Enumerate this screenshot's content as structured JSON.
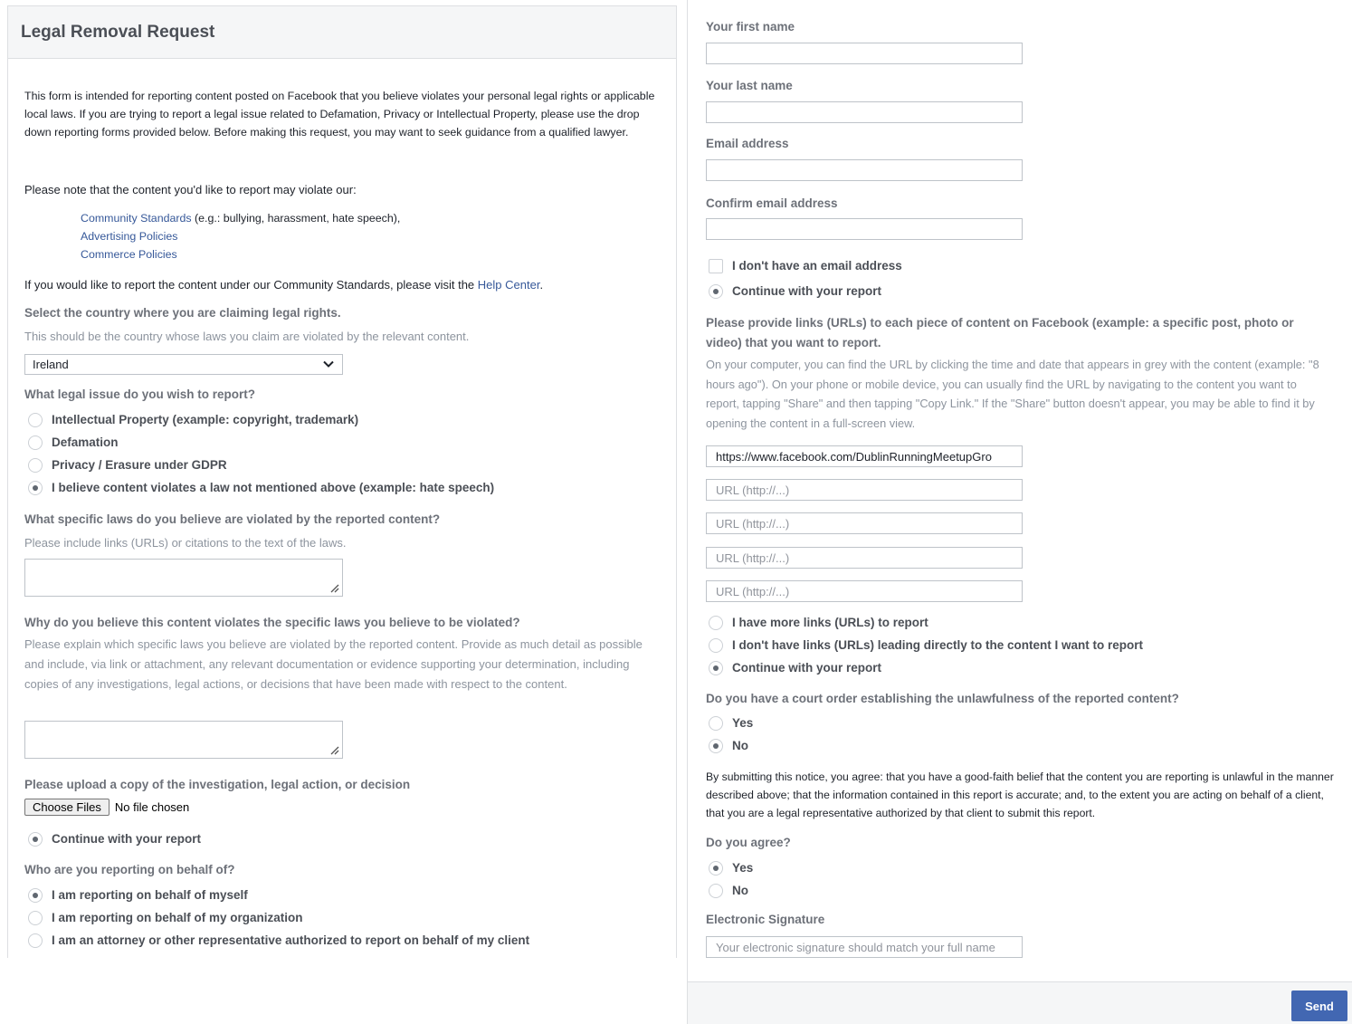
{
  "left": {
    "title": "Legal Removal Request",
    "intro": "This form is intended for reporting content posted on Facebook that you believe violates your personal legal rights or applicable local laws. If you are trying to report a legal issue related to Defamation, Privacy or Intellectual Property, please use the drop down reporting forms provided below. Before making this request, you may want to seek guidance from a qualified lawyer.",
    "note": "Please note that the content you'd like to report may violate our:",
    "policies": [
      {
        "link": "Community Standards",
        "suffix": " (e.g.: bullying, harassment, hate speech),"
      },
      {
        "link": "Advertising Policies",
        "suffix": ""
      },
      {
        "link": "Commerce Policies",
        "suffix": ""
      }
    ],
    "help_prefix": "If you would like to report the content under our Community Standards, please visit the ",
    "help_link": "Help Center",
    "help_suffix": ".",
    "country_q": "Select the country where you are claiming legal rights.",
    "country_hint": "This should be the country whose laws you claim are violated by the relevant content.",
    "country_value": "Ireland",
    "issue_q": "What legal issue do you wish to report?",
    "issue_options": [
      {
        "label": "Intellectual Property (example: copyright, trademark)",
        "selected": false
      },
      {
        "label": "Defamation",
        "selected": false
      },
      {
        "label": "Privacy / Erasure under GDPR",
        "selected": false
      },
      {
        "label": "I believe content violates a law not mentioned above (example: hate speech)",
        "selected": true
      }
    ],
    "laws_q": "What specific laws do you believe are violated by the reported content?",
    "laws_hint": "Please include links (URLs) or citations to the text of the laws.",
    "why_q": "Why do you believe this content violates the specific laws you believe to be violated?",
    "why_hint": "Please explain which specific laws you believe are violated by the reported content. Provide as much detail as possible and include, via link or attachment, any relevant documentation or evidence supporting your determination, including copies of any investigations, legal actions, or decisions that have been made with respect to the content.",
    "upload_q": "Please upload a copy of the investigation, legal action, or decision",
    "choose_files": "Choose Files",
    "no_file": "No file chosen",
    "continue_label": "Continue with your report",
    "behalf_q": "Who are you reporting on behalf of?",
    "behalf_options": [
      {
        "label": "I am reporting on behalf of myself",
        "selected": true
      },
      {
        "label": "I am reporting on behalf of my organization",
        "selected": false
      },
      {
        "label": "I am an attorney or other representative authorized to report on behalf of my client",
        "selected": false
      }
    ]
  },
  "right": {
    "first_name_label": "Your first name",
    "last_name_label": "Your last name",
    "email_label": "Email address",
    "confirm_email_label": "Confirm email address",
    "no_email_label": "I don't have an email address",
    "continue_label": "Continue with your report",
    "links_q": "Please provide links (URLs) to each piece of content on Facebook (example: a specific post, photo or video) that you want to report.",
    "links_hint": "On your computer, you can find the URL by clicking the time and date that appears in grey with the content (example: \"8 hours ago\"). On your phone or mobile device, you can usually find the URL by navigating to the content you want to report, tapping \"Share\" and then tapping \"Copy Link.\" If the \"Share\" button doesn't appear, you may be able to find it by opening the content in a full-screen view.",
    "url_value": "https://www.facebook.com/DublinRunningMeetupGro",
    "url_placeholder": "URL (http://...)",
    "more_links_label": "I have more links (URLs) to report",
    "no_links_label": "I don't have links (URLs) leading directly to the content I want to report",
    "continue_label_2": "Continue with your report",
    "court_q": "Do you have a court order establishing the unlawfulness of the reported content?",
    "court_yes": "Yes",
    "court_no": "No",
    "agree_text": "By submitting this notice, you agree: that you have a good-faith belief that the content you are reporting is unlawful in the manner described above; that the information contained in this report is accurate; and, to the extent you are acting on behalf of a client, that you are a legal representative authorized by that client to submit this report.",
    "agree_q": "Do you agree?",
    "agree_yes": "Yes",
    "agree_no": "No",
    "signature_label": "Electronic Signature",
    "signature_placeholder": "Your electronic signature should match your full name",
    "send_label": "Send"
  },
  "colors": {
    "link": "#365899",
    "button": "#4267b2",
    "header_bg": "#f5f6f7",
    "border": "#dddfe2"
  }
}
